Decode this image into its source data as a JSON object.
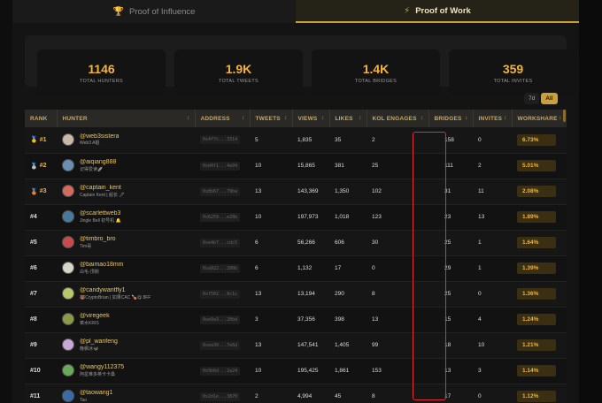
{
  "tabs": [
    {
      "label": "Proof of Influence",
      "icon": "trophy-icon",
      "glyph": "🏆",
      "active": false
    },
    {
      "label": "Proof of Work",
      "icon": "lightning-icon",
      "glyph": "⚡",
      "active": true
    }
  ],
  "stats": [
    {
      "value": "1146",
      "label": "TOTAL HUNTERS"
    },
    {
      "value": "1.9K",
      "label": "TOTAL TWEETS"
    },
    {
      "value": "1.4K",
      "label": "TOTAL BRIDGES"
    },
    {
      "value": "359",
      "label": "TOTAL INVITES"
    }
  ],
  "range": {
    "options": [
      "7d",
      "All"
    ],
    "selected": "All"
  },
  "table": {
    "columns": [
      "RANK",
      "HUNTER",
      "ADDRESS",
      "TWEETS",
      "VIEWS",
      "LIKES",
      "KOL ENGAGES",
      "BRIDGES",
      "INVITES",
      "WORKSHARE"
    ],
    "rows": [
      {
        "rank": "#1",
        "medal": "🥇",
        "handle": "@web3sistera",
        "sub": "Web3 A姐",
        "address": "0x4f7c...3314",
        "tweets": "5",
        "views": "1,835",
        "likes": "35",
        "kol": "2",
        "bridges": "158",
        "invites": "0",
        "share": "6.73%",
        "avatar": "#c9b8a8"
      },
      {
        "rank": "#2",
        "medal": "🥈",
        "handle": "@aiqiang888",
        "sub": "记得爱读🚀",
        "address": "0xd4f1...4a94",
        "tweets": "10",
        "views": "15,865",
        "likes": "381",
        "kol": "25",
        "bridges": "111",
        "invites": "2",
        "share": "5.01%",
        "avatar": "#6a8fb5"
      },
      {
        "rank": "#3",
        "medal": "🥉",
        "handle": "@captain_kent",
        "sub": "Captain Kent | 船长 🖋",
        "address": "0x8b67...79ba",
        "tweets": "13",
        "views": "143,369",
        "likes": "1,350",
        "kol": "102",
        "bridges": "31",
        "invites": "11",
        "share": "2.08%",
        "avatar": "#d46a5c"
      },
      {
        "rank": "#4",
        "medal": "",
        "handle": "@scarlettweb3",
        "sub": "Jingle Bell 初号机 🔔",
        "address": "0x6259...e28b",
        "tweets": "10",
        "views": "197,973",
        "likes": "1,018",
        "kol": "123",
        "bridges": "23",
        "invites": "13",
        "share": "1.89%",
        "avatar": "#4a7a9a"
      },
      {
        "rank": "#5",
        "medal": "",
        "handle": "@timbro_bro",
        "sub": "Tim哥",
        "address": "0xe4b7...cdc5",
        "tweets": "6",
        "views": "56,266",
        "likes": "606",
        "kol": "30",
        "bridges": "25",
        "invites": "1",
        "share": "1.64%",
        "avatar": "#c84a4a"
      },
      {
        "rank": "#6",
        "medal": "",
        "handle": "@baimao18mm",
        "sub": "白毛-顶侧",
        "address": "0xa922...280b",
        "tweets": "6",
        "views": "1,132",
        "likes": "17",
        "kol": "0",
        "bridges": "29",
        "invites": "1",
        "share": "1.39%",
        "avatar": "#d8d4c8"
      },
      {
        "rank": "#7",
        "medal": "",
        "handle": "@candywantfly1",
        "sub": "🐻CryptoBrian | 如果CAC 🍗😋 8FF",
        "address": "0xf502...8c1c",
        "tweets": "13",
        "views": "13,194",
        "likes": "290",
        "kol": "8",
        "bridges": "25",
        "invites": "0",
        "share": "1.36%",
        "avatar": "#b8c86a"
      },
      {
        "rank": "#8",
        "medal": "",
        "handle": "@viregeek",
        "sub": "菜水KRIS",
        "address": "0xe9a3...20bd",
        "tweets": "3",
        "views": "37,356",
        "likes": "398",
        "kol": "13",
        "bridges": "15",
        "invites": "4",
        "share": "1.24%",
        "avatar": "#8a9a4a"
      },
      {
        "rank": "#9",
        "medal": "",
        "handle": "@pl_wanfeng",
        "sub": "晚枫冰🦋",
        "address": "0xea30...7e6d",
        "tweets": "13",
        "views": "147,541",
        "likes": "1,405",
        "kol": "99",
        "bridges": "18",
        "invites": "10",
        "share": "1.21%",
        "avatar": "#c8a8d8"
      },
      {
        "rank": "#10",
        "medal": "",
        "handle": "@wangy112375",
        "sub": "阿星难多英卡卡桑",
        "address": "0x9b6d...2a24",
        "tweets": "10",
        "views": "195,425",
        "likes": "1,861",
        "kol": "153",
        "bridges": "13",
        "invites": "3",
        "share": "1.14%",
        "avatar": "#6aa85a"
      },
      {
        "rank": "#11",
        "medal": "",
        "handle": "@taowang1",
        "sub": "Tao",
        "address": "0x2d1e...3870",
        "tweets": "2",
        "views": "4,994",
        "likes": "45",
        "kol": "8",
        "bridges": "17",
        "invites": "0",
        "share": "1.12%",
        "avatar": "#3a6aa8"
      }
    ]
  },
  "colors": {
    "accent": "#f2b33a",
    "highlight": "#e03030"
  }
}
